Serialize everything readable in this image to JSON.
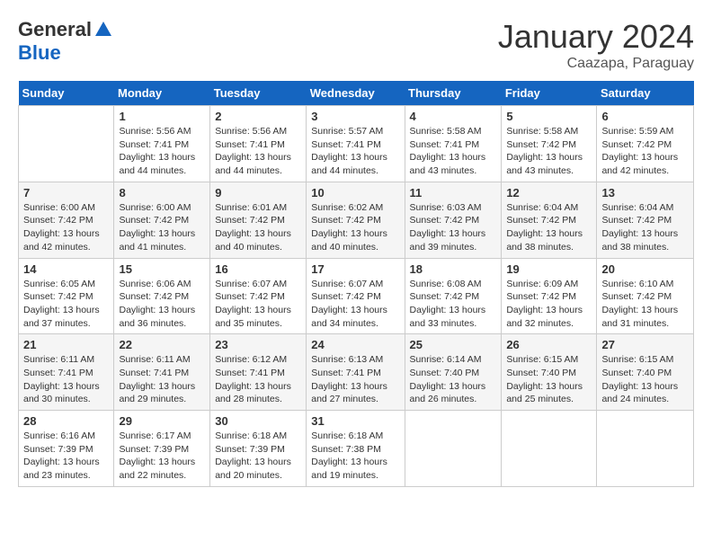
{
  "header": {
    "logo_general": "General",
    "logo_blue": "Blue",
    "month": "January 2024",
    "location": "Caazapa, Paraguay"
  },
  "weekdays": [
    "Sunday",
    "Monday",
    "Tuesday",
    "Wednesday",
    "Thursday",
    "Friday",
    "Saturday"
  ],
  "weeks": [
    [
      {
        "day": "",
        "sunrise": "",
        "sunset": "",
        "daylight": ""
      },
      {
        "day": "1",
        "sunrise": "5:56 AM",
        "sunset": "7:41 PM",
        "daylight": "13 hours and 44 minutes."
      },
      {
        "day": "2",
        "sunrise": "5:56 AM",
        "sunset": "7:41 PM",
        "daylight": "13 hours and 44 minutes."
      },
      {
        "day": "3",
        "sunrise": "5:57 AM",
        "sunset": "7:41 PM",
        "daylight": "13 hours and 44 minutes."
      },
      {
        "day": "4",
        "sunrise": "5:58 AM",
        "sunset": "7:41 PM",
        "daylight": "13 hours and 43 minutes."
      },
      {
        "day": "5",
        "sunrise": "5:58 AM",
        "sunset": "7:42 PM",
        "daylight": "13 hours and 43 minutes."
      },
      {
        "day": "6",
        "sunrise": "5:59 AM",
        "sunset": "7:42 PM",
        "daylight": "13 hours and 42 minutes."
      }
    ],
    [
      {
        "day": "7",
        "sunrise": "6:00 AM",
        "sunset": "7:42 PM",
        "daylight": "13 hours and 42 minutes."
      },
      {
        "day": "8",
        "sunrise": "6:00 AM",
        "sunset": "7:42 PM",
        "daylight": "13 hours and 41 minutes."
      },
      {
        "day": "9",
        "sunrise": "6:01 AM",
        "sunset": "7:42 PM",
        "daylight": "13 hours and 40 minutes."
      },
      {
        "day": "10",
        "sunrise": "6:02 AM",
        "sunset": "7:42 PM",
        "daylight": "13 hours and 40 minutes."
      },
      {
        "day": "11",
        "sunrise": "6:03 AM",
        "sunset": "7:42 PM",
        "daylight": "13 hours and 39 minutes."
      },
      {
        "day": "12",
        "sunrise": "6:04 AM",
        "sunset": "7:42 PM",
        "daylight": "13 hours and 38 minutes."
      },
      {
        "day": "13",
        "sunrise": "6:04 AM",
        "sunset": "7:42 PM",
        "daylight": "13 hours and 38 minutes."
      }
    ],
    [
      {
        "day": "14",
        "sunrise": "6:05 AM",
        "sunset": "7:42 PM",
        "daylight": "13 hours and 37 minutes."
      },
      {
        "day": "15",
        "sunrise": "6:06 AM",
        "sunset": "7:42 PM",
        "daylight": "13 hours and 36 minutes."
      },
      {
        "day": "16",
        "sunrise": "6:07 AM",
        "sunset": "7:42 PM",
        "daylight": "13 hours and 35 minutes."
      },
      {
        "day": "17",
        "sunrise": "6:07 AM",
        "sunset": "7:42 PM",
        "daylight": "13 hours and 34 minutes."
      },
      {
        "day": "18",
        "sunrise": "6:08 AM",
        "sunset": "7:42 PM",
        "daylight": "13 hours and 33 minutes."
      },
      {
        "day": "19",
        "sunrise": "6:09 AM",
        "sunset": "7:42 PM",
        "daylight": "13 hours and 32 minutes."
      },
      {
        "day": "20",
        "sunrise": "6:10 AM",
        "sunset": "7:42 PM",
        "daylight": "13 hours and 31 minutes."
      }
    ],
    [
      {
        "day": "21",
        "sunrise": "6:11 AM",
        "sunset": "7:41 PM",
        "daylight": "13 hours and 30 minutes."
      },
      {
        "day": "22",
        "sunrise": "6:11 AM",
        "sunset": "7:41 PM",
        "daylight": "13 hours and 29 minutes."
      },
      {
        "day": "23",
        "sunrise": "6:12 AM",
        "sunset": "7:41 PM",
        "daylight": "13 hours and 28 minutes."
      },
      {
        "day": "24",
        "sunrise": "6:13 AM",
        "sunset": "7:41 PM",
        "daylight": "13 hours and 27 minutes."
      },
      {
        "day": "25",
        "sunrise": "6:14 AM",
        "sunset": "7:40 PM",
        "daylight": "13 hours and 26 minutes."
      },
      {
        "day": "26",
        "sunrise": "6:15 AM",
        "sunset": "7:40 PM",
        "daylight": "13 hours and 25 minutes."
      },
      {
        "day": "27",
        "sunrise": "6:15 AM",
        "sunset": "7:40 PM",
        "daylight": "13 hours and 24 minutes."
      }
    ],
    [
      {
        "day": "28",
        "sunrise": "6:16 AM",
        "sunset": "7:39 PM",
        "daylight": "13 hours and 23 minutes."
      },
      {
        "day": "29",
        "sunrise": "6:17 AM",
        "sunset": "7:39 PM",
        "daylight": "13 hours and 22 minutes."
      },
      {
        "day": "30",
        "sunrise": "6:18 AM",
        "sunset": "7:39 PM",
        "daylight": "13 hours and 20 minutes."
      },
      {
        "day": "31",
        "sunrise": "6:18 AM",
        "sunset": "7:38 PM",
        "daylight": "13 hours and 19 minutes."
      },
      {
        "day": "",
        "sunrise": "",
        "sunset": "",
        "daylight": ""
      },
      {
        "day": "",
        "sunrise": "",
        "sunset": "",
        "daylight": ""
      },
      {
        "day": "",
        "sunrise": "",
        "sunset": "",
        "daylight": ""
      }
    ]
  ]
}
